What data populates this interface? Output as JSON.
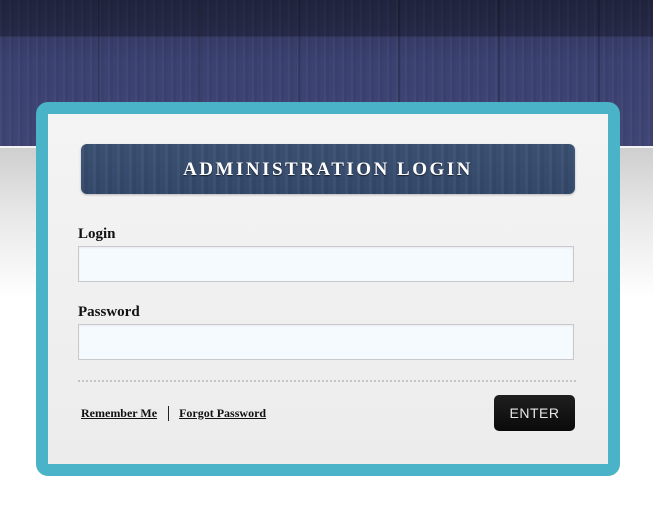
{
  "header": {
    "title": "ADMINISTRATION LOGIN"
  },
  "form": {
    "login_label": "Login",
    "login_value": "",
    "password_label": "Password",
    "password_value": ""
  },
  "footer": {
    "remember_label": "Remember Me",
    "forgot_label": "Forgot Password",
    "enter_label": "ENTER"
  },
  "colors": {
    "frame_accent": "#4bb3c8",
    "header_bar": "#34486a",
    "background_top": "#3b4170",
    "input_background": "#f5faff",
    "button_background": "#111111"
  }
}
